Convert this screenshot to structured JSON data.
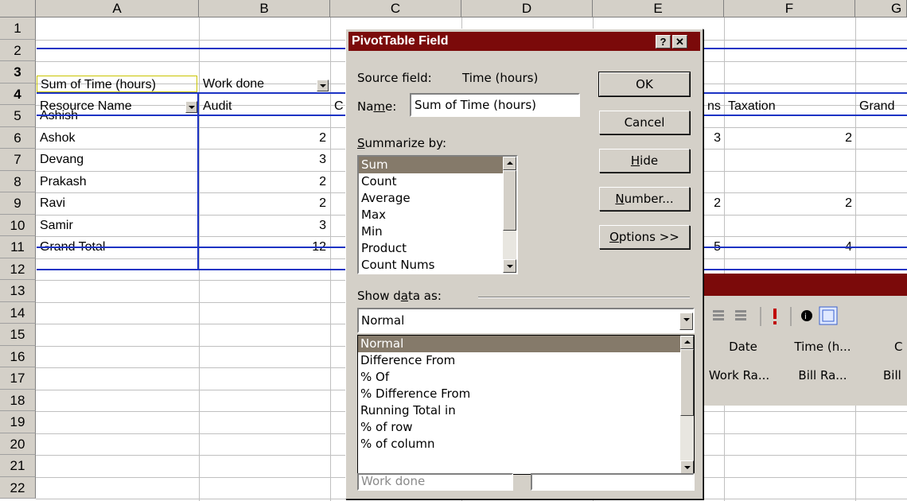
{
  "columns": [
    "A",
    "B",
    "C",
    "D",
    "E",
    "F",
    "G"
  ],
  "rows": [
    "1",
    "2",
    "3",
    "4",
    "5",
    "6",
    "7",
    "8",
    "9",
    "10",
    "11",
    "12",
    "13",
    "14",
    "15",
    "16",
    "17",
    "18",
    "19",
    "20",
    "21",
    "22"
  ],
  "pivot": {
    "data_field": "Sum of Time (hours)",
    "col_field": "Work done",
    "row_field": "Resource Name",
    "col_items": [
      "Audit",
      "C",
      "ns",
      "Taxation",
      "Grand"
    ],
    "names": [
      "Ashish",
      "Ashok",
      "Devang",
      "Prakash",
      "Ravi",
      "Samir",
      "Grand Total"
    ],
    "audit": [
      "",
      "2",
      "3",
      "2",
      "2",
      "3",
      "12"
    ],
    "col_e": [
      "",
      "3",
      "",
      "",
      "2",
      "",
      "5"
    ],
    "taxation": [
      "",
      "2",
      "",
      "",
      "2",
      "",
      "4"
    ]
  },
  "pivot_toolbar": {
    "fields": [
      "Date",
      "Time (h...",
      "C"
    ],
    "fields2": [
      "Work Ra...",
      "Bill Ra...",
      "Bill"
    ]
  },
  "dialog": {
    "title": "PivotTable Field",
    "help_btn": "?",
    "close_btn": "✕",
    "source_label": "Source field:",
    "source_value": "Time (hours)",
    "name_label": "Name:",
    "name_value": "Sum of Time (hours)",
    "summarize_label": "Summarize by:",
    "summarize_options": [
      "Sum",
      "Count",
      "Average",
      "Max",
      "Min",
      "Product",
      "Count Nums"
    ],
    "summarize_selected": "Sum",
    "show_label": "Show data as:",
    "show_value": "Normal",
    "show_options": [
      "Normal",
      "Difference From",
      "% Of",
      "% Difference From",
      "Running Total in",
      "% of row",
      "% of column"
    ],
    "base_field": "Work done",
    "buttons": {
      "ok": "OK",
      "cancel": "Cancel",
      "hide": "Hide",
      "number": "Number...",
      "options": "Options >>"
    }
  }
}
